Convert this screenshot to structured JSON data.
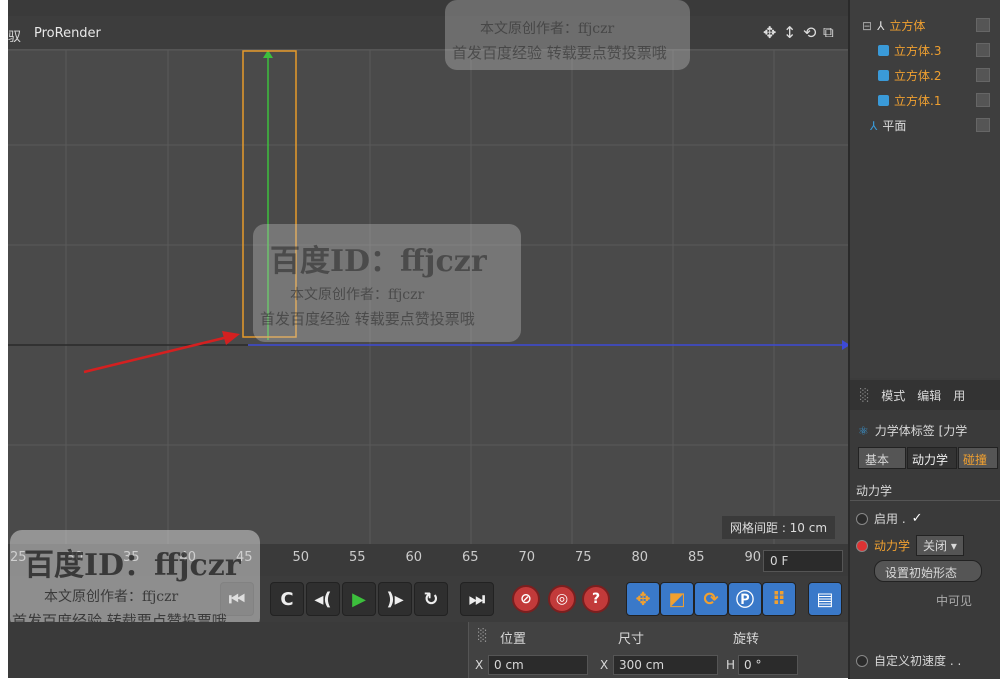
{
  "viewport": {
    "menu_fragment": "驭",
    "renderer": "ProRender",
    "grid_spacing": "网格间距 : 10 cm"
  },
  "timeline": {
    "ticks": [
      "25",
      "30",
      "35",
      "40",
      "45",
      "50",
      "55",
      "60",
      "65",
      "70",
      "75",
      "80",
      "85",
      "90"
    ],
    "frame_field": "0 F"
  },
  "coords": {
    "position_label": "位置",
    "size_label": "尺寸",
    "rotation_label": "旋转",
    "x_label": "X",
    "x_pos": "0 cm",
    "x2_label": "X",
    "x_size": "300 cm",
    "h_label": "H",
    "h_rot": "0 °"
  },
  "objects": {
    "root": "立方体",
    "children": [
      "立方体.3",
      "立方体.2",
      "立方体.1"
    ],
    "plane": "平面"
  },
  "attributes": {
    "menu": [
      "模式",
      "编辑",
      "用"
    ],
    "tag_title": "力学体标签 [力学",
    "tabs": [
      "基本",
      "动力学",
      "碰撞"
    ],
    "section": "动力学",
    "enable_label": "启用 .",
    "dynamics_label": "动力学",
    "dynamics_value": "关闭",
    "set_initial": "设置初始形态",
    "visible_fragment": "中可见",
    "custom_velocity": "自定义初速度 . ."
  },
  "watermark": {
    "id_text": "百度ID：ffjczr",
    "line1": "本文原创作者：ffjczr",
    "line2": "首发百度经验  转载要点赞投票哦"
  },
  "colors": {
    "viewport_bg": "#4a4a4a",
    "selection": "#e69a2a",
    "y_axis": "#3cbf3c",
    "z_axis": "#3d4ad6",
    "arrow": "#d42020",
    "active_text": "#f0a030"
  }
}
